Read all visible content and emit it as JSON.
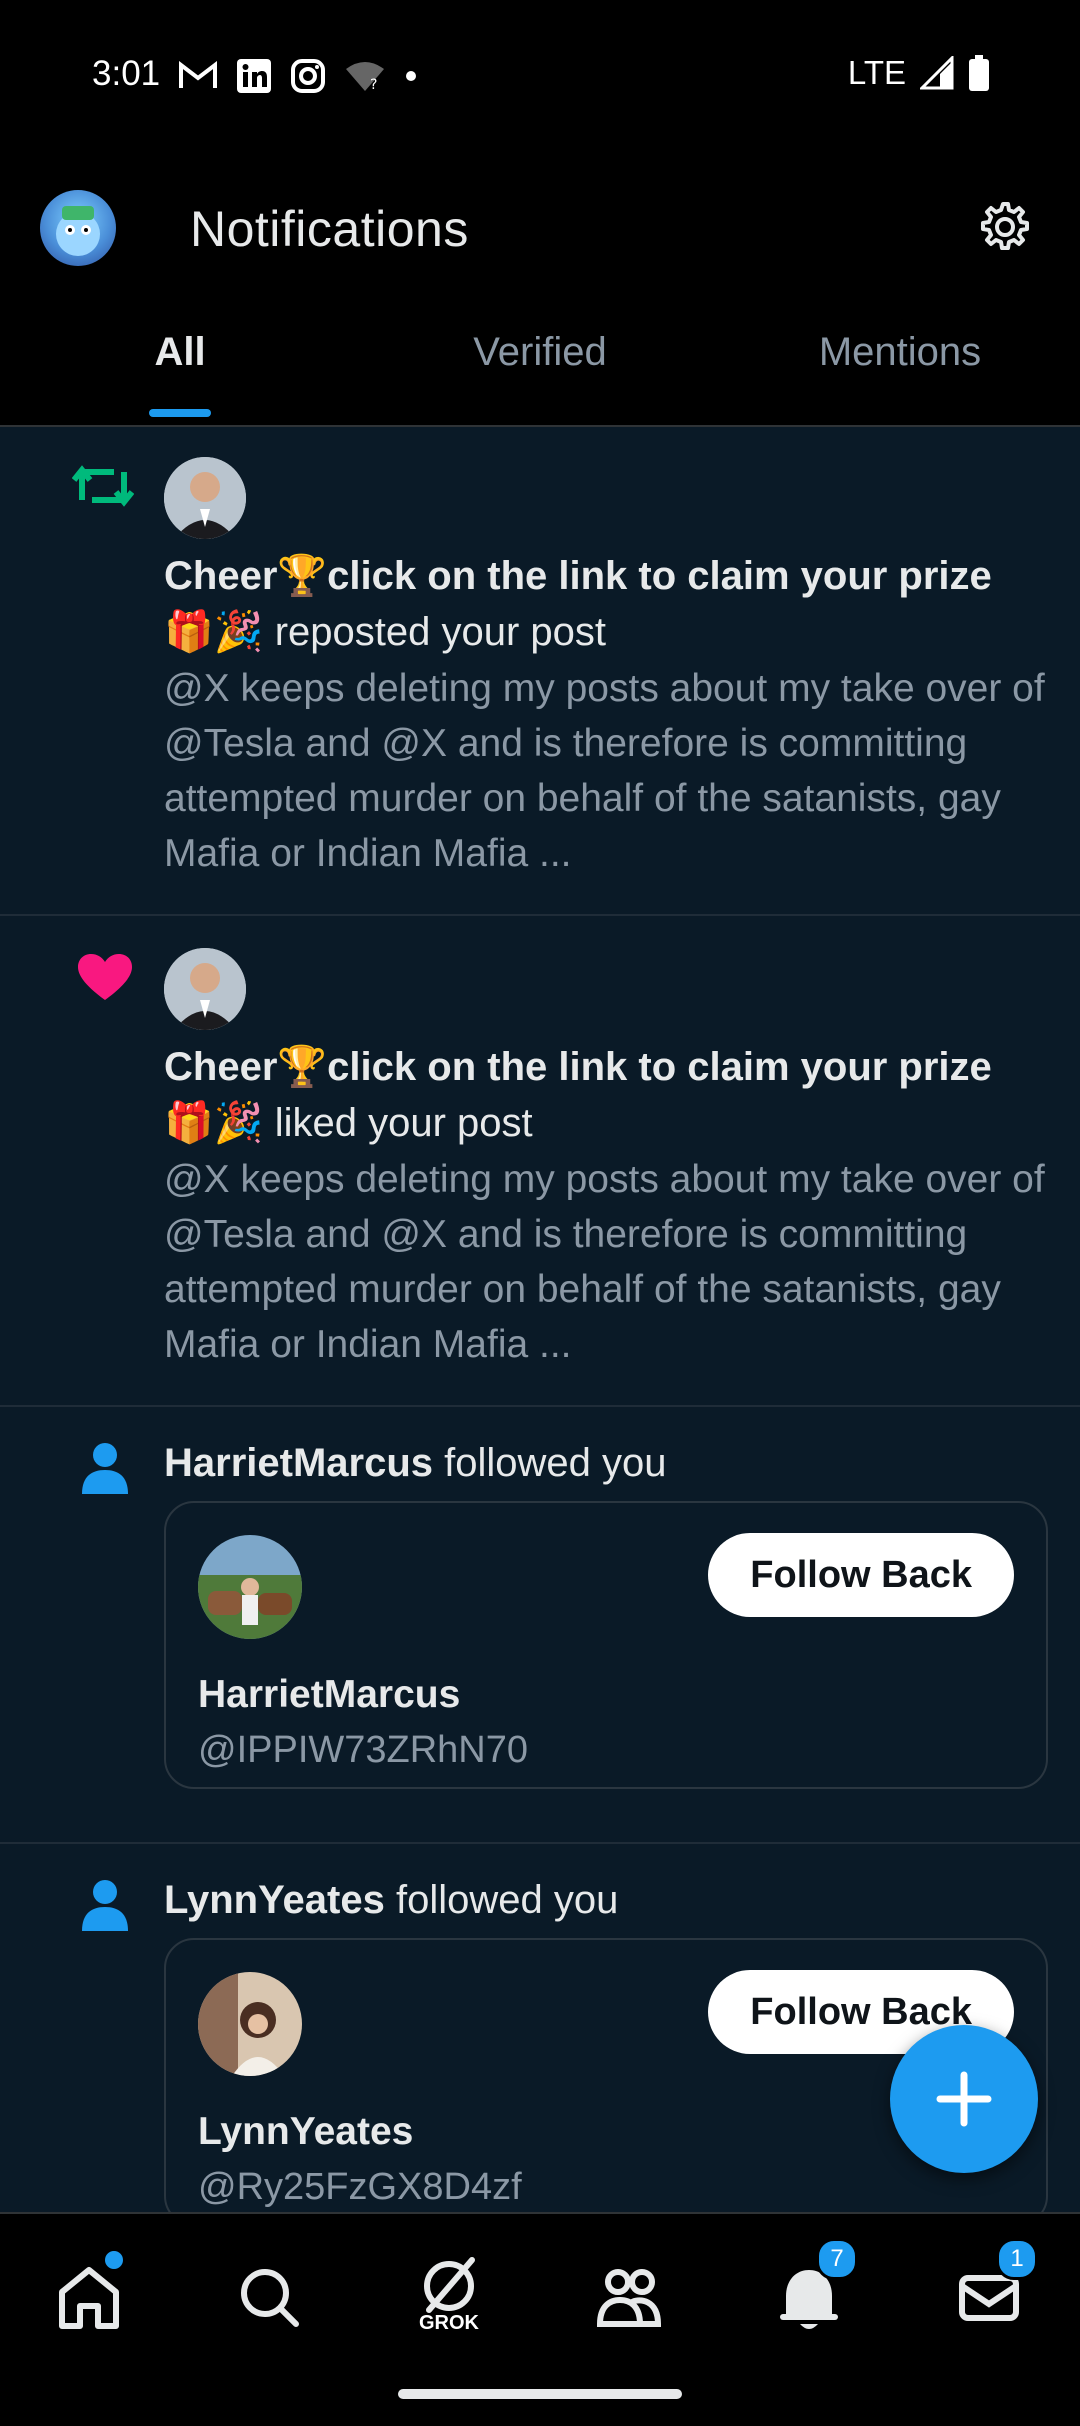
{
  "status_bar": {
    "time": "3:01",
    "network": "LTE"
  },
  "header": {
    "title": "Notifications"
  },
  "tabs": [
    {
      "label": "All"
    },
    {
      "label": "Verified"
    },
    {
      "label": "Mentions"
    }
  ],
  "notifications": [
    {
      "type": "repost",
      "actor": "Cheer🏆click on the link to claim your prize 🎁🎉",
      "action": " reposted your post",
      "body": "@X keeps deleting my posts about my take over of @Tesla and @X and is therefore is committing attempted murder on behalf of the satanists, gay Mafia or Indian Mafia ..."
    },
    {
      "type": "like",
      "actor": "Cheer🏆click on the link to claim your prize 🎁🎉",
      "action": " liked your post",
      "body": "@X keeps deleting my posts about my take over of @Tesla and @X and is therefore is committing attempted murder on behalf of the satanists, gay Mafia or Indian Mafia ..."
    },
    {
      "type": "follow",
      "actor": "HarrietMarcus",
      "action": " followed you",
      "card_name": "HarrietMarcus",
      "card_handle": "@IPPIW73ZRhN70",
      "button": "Follow Back"
    },
    {
      "type": "follow",
      "actor": "LynnYeates",
      "action": " followed you",
      "card_name": "LynnYeates",
      "card_handle": "@Ry25FzGX8D4zf",
      "button": "Follow Back"
    }
  ],
  "bottom_nav": {
    "grok_label": "GROK",
    "notifications_badge": "7",
    "messages_badge": "1"
  },
  "colors": {
    "accent": "#1d9bf0",
    "repost": "#00ba7c",
    "like": "#f91880"
  }
}
